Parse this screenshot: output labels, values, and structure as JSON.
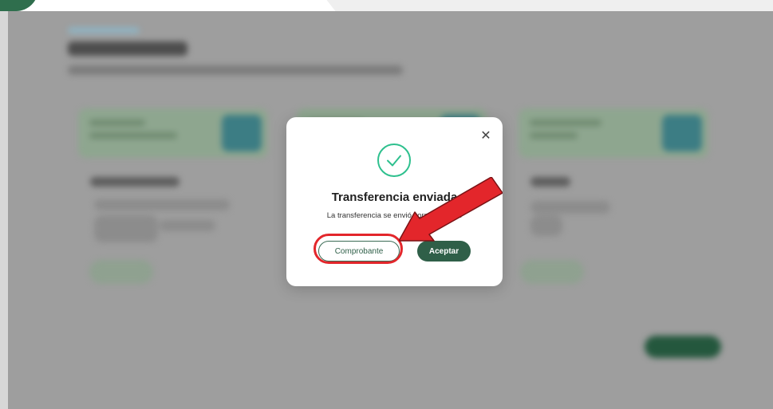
{
  "modal": {
    "close_icon": "close-icon",
    "status_icon": "check-circle-icon",
    "title": "Transferencia enviada",
    "message": "La transferencia se envió correctamente",
    "buttons": {
      "receipt": "Comprobante",
      "accept": "Aceptar"
    }
  },
  "annotation": {
    "arrow_icon": "pointer-arrow-icon",
    "color": "#e3262b"
  },
  "colors": {
    "brand_green": "#2f5f48",
    "check_green": "#2ec08e",
    "overlay": "#9a9a9a"
  }
}
